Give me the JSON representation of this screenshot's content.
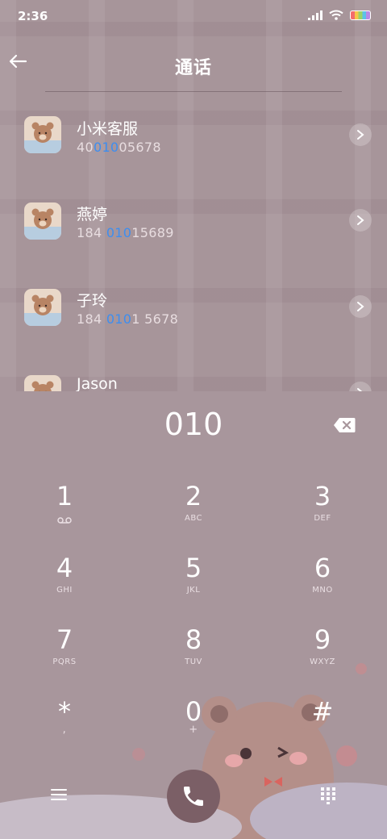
{
  "status_bar": {
    "time": "2:36"
  },
  "header": {
    "title": "通话"
  },
  "contacts": [
    {
      "name": "小米客服",
      "phone_pre": "40",
      "phone_match": "010",
      "phone_post": "05678"
    },
    {
      "name": "燕婷",
      "phone_pre": "184 ",
      "phone_match": "010",
      "phone_post": "15689"
    },
    {
      "name": "子玲",
      "phone_pre": "184 ",
      "phone_match": "010",
      "phone_post": "1 5678"
    },
    {
      "name": "Jason",
      "phone_pre": "",
      "phone_match": "",
      "phone_post": ""
    }
  ],
  "dialer": {
    "input": "010",
    "keys": [
      {
        "digit": "1",
        "sub": ""
      },
      {
        "digit": "2",
        "sub": "ABC"
      },
      {
        "digit": "3",
        "sub": "DEF"
      },
      {
        "digit": "4",
        "sub": "GHI"
      },
      {
        "digit": "5",
        "sub": "JKL"
      },
      {
        "digit": "6",
        "sub": "MNO"
      },
      {
        "digit": "7",
        "sub": "PQRS"
      },
      {
        "digit": "8",
        "sub": "TUV"
      },
      {
        "digit": "9",
        "sub": "WXYZ"
      },
      {
        "digit": "*",
        "sub": ","
      },
      {
        "digit": "0",
        "sub": "+"
      },
      {
        "digit": "#",
        "sub": ""
      }
    ]
  },
  "icons": {
    "back": "back-arrow-icon",
    "chevron": "chevron-right-icon",
    "backspace": "backspace-icon",
    "voicemail": "voicemail-icon",
    "menu": "menu-icon",
    "call": "phone-icon",
    "keypad": "keypad-grid-icon"
  },
  "colors": {
    "highlight": "#3d8ef0",
    "call_button": "#7b5f66"
  }
}
